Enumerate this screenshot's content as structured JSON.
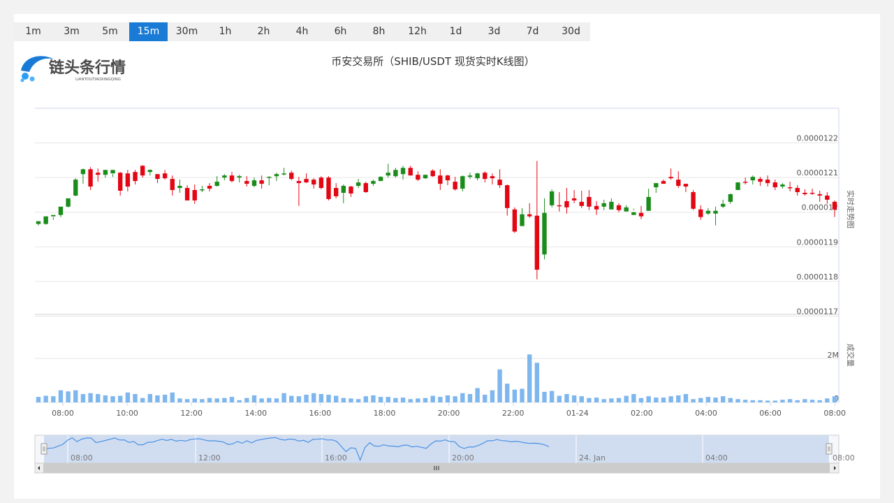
{
  "tabs": [
    {
      "label": "1m"
    },
    {
      "label": "3m"
    },
    {
      "label": "5m"
    },
    {
      "label": "15m",
      "active": true
    },
    {
      "label": "30m"
    },
    {
      "label": "1h"
    },
    {
      "label": "2h"
    },
    {
      "label": "4h"
    },
    {
      "label": "6h"
    },
    {
      "label": "8h"
    },
    {
      "label": "12h"
    },
    {
      "label": "1d"
    },
    {
      "label": "3d"
    },
    {
      "label": "7d"
    },
    {
      "label": "30d"
    }
  ],
  "logo": {
    "text": "链头条行情",
    "subtext": "LIANTOUTIAOXINGQING"
  },
  "colors": {
    "up": "#1a8c1a",
    "down": "#e30613",
    "volume": "#7eb6ee",
    "accent": "#1a7bd6"
  },
  "chart_data": {
    "type": "candlestick",
    "title": "币安交易所（SHIB/USDT 现货实时K线图）",
    "price_axis_label": "实时走势图",
    "volume_axis_label": "成交量",
    "price_ticks": [
      "0.0000122",
      "0.0000121",
      "0.000012",
      "0.0000119",
      "0.0000118",
      "0.0000117"
    ],
    "price_tick_values": [
      1.22e-05,
      1.21e-05,
      1.2e-05,
      1.19e-05,
      1.18e-05,
      1.17e-05
    ],
    "price_range": [
      1.17e-05,
      1.23e-05
    ],
    "volume_ticks": [
      "2M",
      "0"
    ],
    "volume_tick_values": [
      2000000,
      0
    ],
    "volume_range": [
      0,
      2000000
    ],
    "time_ticks": [
      "08:00",
      "10:00",
      "12:00",
      "14:00",
      "16:00",
      "18:00",
      "20:00",
      "22:00",
      "01-24",
      "02:00",
      "04:00",
      "06:00",
      "08:00"
    ],
    "interval": "15m",
    "candles": [
      [
        1.1966,
        1.1974,
        1.1962,
        1.1968
      ],
      [
        1.1966,
        1.1988,
        1.1964,
        1.1986
      ],
      [
        1.1988,
        1.1992,
        1.1978,
        1.1986
      ],
      [
        1.1992,
        1.2016,
        1.1986,
        1.201
      ],
      [
        1.2016,
        1.204,
        1.2014,
        1.2032
      ],
      [
        1.2048,
        1.2094,
        1.2046,
        1.2098
      ],
      [
        1.211,
        1.2124,
        1.2082,
        1.2126
      ],
      [
        1.2124,
        1.2074,
        1.2064,
        1.213
      ],
      [
        1.2114,
        1.2108,
        1.2088,
        1.2126
      ],
      [
        1.2108,
        1.2122,
        1.21,
        1.2122
      ],
      [
        1.2112,
        1.2122,
        1.2102,
        1.211
      ],
      [
        1.2114,
        1.2062,
        1.2048,
        1.2116
      ],
      [
        1.2112,
        1.2074,
        1.206,
        1.2122
      ],
      [
        1.2116,
        1.209,
        1.208,
        1.2122
      ],
      [
        1.2134,
        1.2106,
        1.21,
        1.2136
      ],
      [
        1.2116,
        1.2122,
        1.2106,
        1.2124
      ],
      [
        1.211,
        1.2096,
        1.2084,
        1.2108
      ],
      [
        1.2112,
        1.2098,
        1.2094,
        1.2122
      ],
      [
        1.2096,
        1.2064,
        1.2048,
        1.2106
      ],
      [
        1.207,
        1.2076,
        1.2056,
        1.2094
      ],
      [
        1.207,
        1.2034,
        1.2034,
        1.2078
      ],
      [
        1.2064,
        1.2034,
        1.2024,
        1.208
      ],
      [
        1.2064,
        1.2066,
        1.2058,
        1.2076
      ],
      [
        1.2076,
        1.2068,
        1.206,
        1.2084
      ],
      [
        1.2076,
        1.2088,
        1.2074,
        1.2104
      ],
      [
        1.21,
        1.2106,
        1.2092,
        1.211
      ],
      [
        1.2106,
        1.209,
        1.2086,
        1.2116
      ],
      [
        1.21,
        1.2104,
        1.2086,
        1.2108
      ],
      [
        1.209,
        1.2082,
        1.2074,
        1.2104
      ],
      [
        1.2076,
        1.2092,
        1.2072,
        1.21
      ],
      [
        1.2092,
        1.2082,
        1.2068,
        1.2106
      ],
      [
        1.21,
        1.2102,
        1.2078,
        1.2104
      ],
      [
        1.2104,
        1.211,
        1.209,
        1.2114
      ],
      [
        1.211,
        1.2112,
        1.2106,
        1.2128
      ],
      [
        1.2114,
        1.2096,
        1.2092,
        1.212
      ],
      [
        1.209,
        1.2084,
        1.2018,
        1.2102
      ],
      [
        1.2096,
        1.2086,
        1.2084,
        1.2112
      ],
      [
        1.2094,
        1.208,
        1.2068,
        1.2098
      ],
      [
        1.21,
        1.207,
        1.2066,
        1.2104
      ],
      [
        1.21,
        1.2038,
        1.2034,
        1.2104
      ],
      [
        1.207,
        1.2046,
        1.204,
        1.2084
      ],
      [
        1.2056,
        1.2076,
        1.2026,
        1.208
      ],
      [
        1.2074,
        1.2054,
        1.2044,
        1.2076
      ],
      [
        1.2076,
        1.2086,
        1.207,
        1.2096
      ],
      [
        1.2084,
        1.2058,
        1.2056,
        1.2088
      ],
      [
        1.2082,
        1.209,
        1.2076,
        1.2094
      ],
      [
        1.209,
        1.2102,
        1.2094,
        1.2104
      ],
      [
        1.2106,
        1.2114,
        1.21,
        1.214
      ],
      [
        1.2104,
        1.2122,
        1.21,
        1.2128
      ],
      [
        1.211,
        1.2128,
        1.2094,
        1.2134
      ],
      [
        1.2128,
        1.2106,
        1.2106,
        1.2134
      ],
      [
        1.2108,
        1.2094,
        1.209,
        1.2118
      ],
      [
        1.2098,
        1.2108,
        1.2096,
        1.2108
      ],
      [
        1.212,
        1.2104,
        1.2102,
        1.2124
      ],
      [
        1.2106,
        1.2082,
        1.2064,
        1.2124
      ],
      [
        1.2106,
        1.2092,
        1.2078,
        1.2108
      ],
      [
        1.2088,
        1.2066,
        1.2062,
        1.2102
      ],
      [
        1.2068,
        1.2104,
        1.206,
        1.2106
      ],
      [
        1.2102,
        1.2106,
        1.2096,
        1.2114
      ],
      [
        1.2098,
        1.2112,
        1.2092,
        1.2114
      ],
      [
        1.2114,
        1.2096,
        1.2086,
        1.2118
      ],
      [
        1.2104,
        1.2098,
        1.208,
        1.2112
      ],
      [
        1.2094,
        1.2078,
        1.207,
        1.2124
      ],
      [
        1.2078,
        1.2012,
        1.199,
        1.208
      ],
      [
        1.2008,
        1.1944,
        1.194,
        1.2014
      ],
      [
        1.196,
        1.1994,
        1.1962,
        1.2012
      ],
      [
        1.1994,
        1.1988,
        1.1984,
        1.2026
      ],
      [
        1.199,
        1.1834,
        1.1806,
        1.2148
      ],
      [
        1.1878,
        1.1998,
        1.1864,
        1.204
      ],
      [
        1.202,
        1.206,
        1.2014,
        1.2066
      ],
      [
        1.202,
        1.2018,
        1.2002,
        1.2058
      ],
      [
        1.2032,
        1.2014,
        1.1996,
        1.207
      ],
      [
        1.204,
        1.2034,
        1.2026,
        1.2064
      ],
      [
        1.203,
        1.2018,
        1.2012,
        1.2062
      ],
      [
        1.2044,
        1.2016,
        1.2006,
        1.2064
      ],
      [
        1.2018,
        1.2008,
        1.1992,
        1.2032
      ],
      [
        1.2016,
        1.2026,
        1.2006,
        1.2036
      ],
      [
        1.2008,
        1.203,
        1.2024,
        1.204
      ],
      [
        1.202,
        1.2006,
        1.2,
        1.2026
      ],
      [
        1.2002,
        1.2014,
        1.2006,
        1.202
      ],
      [
        1.1992,
        1.2,
        1.2006,
        1.201
      ],
      [
        1.1998,
        1.1988,
        1.198,
        1.2018
      ],
      [
        1.2004,
        1.2044,
        1.2004,
        1.2068
      ],
      [
        1.2072,
        1.2084,
        1.2056,
        1.2084
      ],
      [
        1.209,
        1.2082,
        1.2084,
        1.2094
      ],
      [
        1.2102,
        1.2098,
        1.2094,
        1.2126
      ],
      [
        1.2094,
        1.2076,
        1.207,
        1.2118
      ],
      [
        1.2082,
        1.2074,
        1.2058,
        1.2082
      ],
      [
        1.2058,
        1.201,
        1.2006,
        1.2064
      ],
      [
        1.2008,
        1.1986,
        1.1978,
        1.202
      ],
      [
        1.1996,
        1.2004,
        1.1992,
        1.2012
      ],
      [
        1.1996,
        1.2004,
        1.1962,
        1.2016
      ],
      [
        1.2016,
        1.2024,
        1.2012,
        1.2036
      ],
      [
        1.203,
        1.2052,
        1.2024,
        1.2054
      ],
      [
        1.2064,
        1.2086,
        1.207,
        1.2086
      ],
      [
        1.2088,
        1.2086,
        1.208,
        1.21
      ],
      [
        1.2092,
        1.2102,
        1.208,
        1.2106
      ],
      [
        1.2096,
        1.2088,
        1.2076,
        1.2102
      ],
      [
        1.2094,
        1.2084,
        1.2074,
        1.2106
      ],
      [
        1.2086,
        1.2072,
        1.2064,
        1.2094
      ],
      [
        1.2074,
        1.208,
        1.2068,
        1.2084
      ],
      [
        1.2072,
        1.207,
        1.206,
        1.2088
      ],
      [
        1.207,
        1.2058,
        1.2048,
        1.2078
      ],
      [
        1.2056,
        1.2052,
        1.2048,
        1.2066
      ],
      [
        1.2056,
        1.2054,
        1.205,
        1.2068
      ],
      [
        1.2052,
        1.2048,
        1.203,
        1.2062
      ],
      [
        1.2048,
        1.2036,
        1.2024,
        1.2058
      ],
      [
        1.203,
        1.2008,
        1.1986,
        1.2034
      ]
    ],
    "volumes": [
      0.25,
      0.3,
      0.28,
      0.55,
      0.5,
      0.55,
      0.38,
      0.42,
      0.38,
      0.32,
      0.28,
      0.3,
      0.45,
      0.38,
      0.2,
      0.38,
      0.32,
      0.35,
      0.45,
      0.18,
      0.15,
      0.18,
      0.15,
      0.2,
      0.18,
      0.2,
      0.25,
      0.1,
      0.2,
      0.32,
      0.18,
      0.2,
      0.18,
      0.42,
      0.3,
      0.28,
      0.35,
      0.42,
      0.38,
      0.35,
      0.3,
      0.2,
      0.18,
      0.15,
      0.28,
      0.32,
      0.25,
      0.25,
      0.2,
      0.22,
      0.15,
      0.18,
      0.2,
      0.3,
      0.25,
      0.32,
      0.28,
      0.42,
      0.38,
      0.65,
      0.35,
      0.55,
      1.5,
      0.85,
      0.58,
      0.62,
      2.18,
      1.8,
      0.48,
      0.52,
      0.3,
      0.38,
      0.32,
      0.28,
      0.2,
      0.22,
      0.15,
      0.18,
      0.2,
      0.3,
      0.38,
      0.2,
      0.28,
      0.22,
      0.22,
      0.28,
      0.32,
      0.38,
      0.15,
      0.2,
      0.25,
      0.22,
      0.28,
      0.2,
      0.15,
      0.12,
      0.1,
      0.1,
      0.08,
      0.08,
      0.12,
      0.15,
      0.1,
      0.15,
      0.12,
      0.1,
      0.18,
      0.28
    ],
    "navigator_labels": [
      "08:00",
      "12:00",
      "16:00",
      "20:00",
      "24. Jan",
      "04:00",
      "08:00"
    ]
  }
}
